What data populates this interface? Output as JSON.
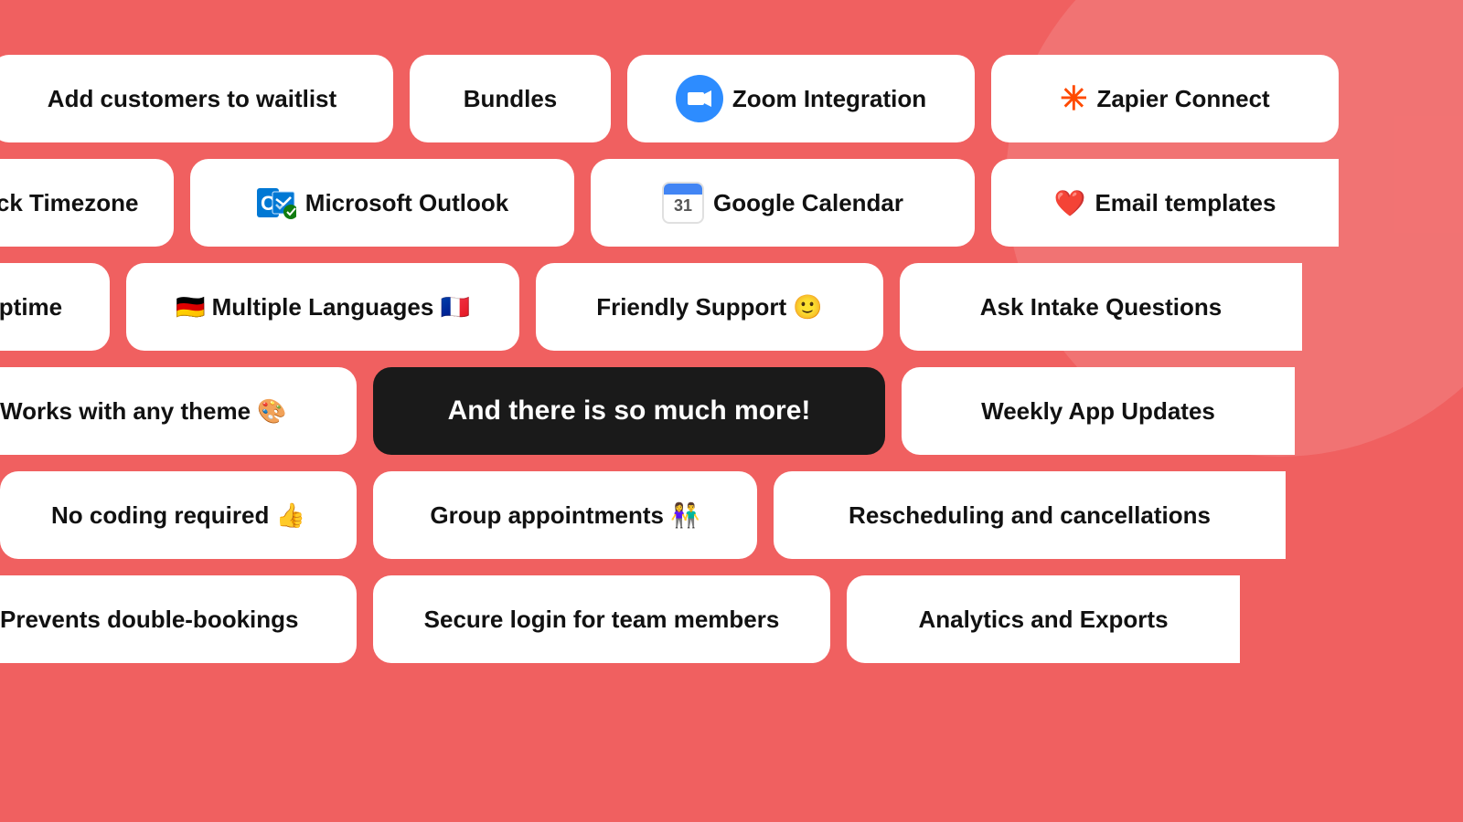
{
  "background": "#f06060",
  "rows": [
    {
      "id": "row1",
      "chips": [
        {
          "id": "add-waitlist",
          "label": "Add customers to waitlist",
          "icon": null,
          "iconType": null,
          "dark": false
        },
        {
          "id": "bundles",
          "label": "Bundles",
          "icon": null,
          "iconType": null,
          "dark": false
        },
        {
          "id": "zoom",
          "label": "Zoom Integration",
          "icon": "zoom",
          "iconType": "zoom",
          "dark": false
        },
        {
          "id": "zapier",
          "label": "Zapier Connect",
          "icon": "zapier",
          "iconType": "zapier",
          "dark": false
        }
      ]
    },
    {
      "id": "row2",
      "chips": [
        {
          "id": "timezone",
          "label": "Lock Timezone",
          "icon": null,
          "iconType": null,
          "dark": false,
          "partial": true
        },
        {
          "id": "outlook",
          "label": "Microsoft Outlook",
          "icon": "outlook",
          "iconType": "outlook",
          "dark": false
        },
        {
          "id": "gcal",
          "label": "Google Calendar",
          "icon": "gcal",
          "iconType": "gcal",
          "dark": false
        },
        {
          "id": "email-templates",
          "label": "Email templates",
          "icon": "heart",
          "iconType": "heart",
          "dark": false
        }
      ]
    },
    {
      "id": "row3",
      "chips": [
        {
          "id": "uptime",
          "label": "Uptime",
          "icon": null,
          "iconType": null,
          "dark": false,
          "partial": true
        },
        {
          "id": "languages",
          "label": "🇩🇪 Multiple Languages 🇫🇷",
          "icon": null,
          "iconType": null,
          "dark": false
        },
        {
          "id": "support",
          "label": "Friendly Support 🙂",
          "icon": null,
          "iconType": null,
          "dark": false
        },
        {
          "id": "intake",
          "label": "Ask Intake Questions",
          "icon": null,
          "iconType": null,
          "dark": false
        }
      ]
    },
    {
      "id": "row4",
      "chips": [
        {
          "id": "theme",
          "label": "Works with any theme 🎨",
          "icon": null,
          "iconType": null,
          "dark": false
        },
        {
          "id": "more",
          "label": "And there is so much more!",
          "icon": null,
          "iconType": null,
          "dark": true
        },
        {
          "id": "weekly-updates",
          "label": "Weekly App Updates",
          "icon": null,
          "iconType": null,
          "dark": false
        }
      ]
    },
    {
      "id": "row5",
      "chips": [
        {
          "id": "no-coding",
          "label": "No coding required 👍",
          "icon": null,
          "iconType": null,
          "dark": false
        },
        {
          "id": "group",
          "label": "Group appointments 👫",
          "icon": null,
          "iconType": null,
          "dark": false
        },
        {
          "id": "reschedule",
          "label": "Rescheduling and cancellations",
          "icon": null,
          "iconType": null,
          "dark": false
        }
      ]
    },
    {
      "id": "row6",
      "chips": [
        {
          "id": "double-bookings",
          "label": "Prevents double-bookings",
          "icon": null,
          "iconType": null,
          "dark": false
        },
        {
          "id": "secure-login",
          "label": "Secure login for team members",
          "icon": null,
          "iconType": null,
          "dark": false
        },
        {
          "id": "analytics",
          "label": "Analytics and Exports",
          "icon": null,
          "iconType": null,
          "dark": false
        }
      ]
    }
  ]
}
